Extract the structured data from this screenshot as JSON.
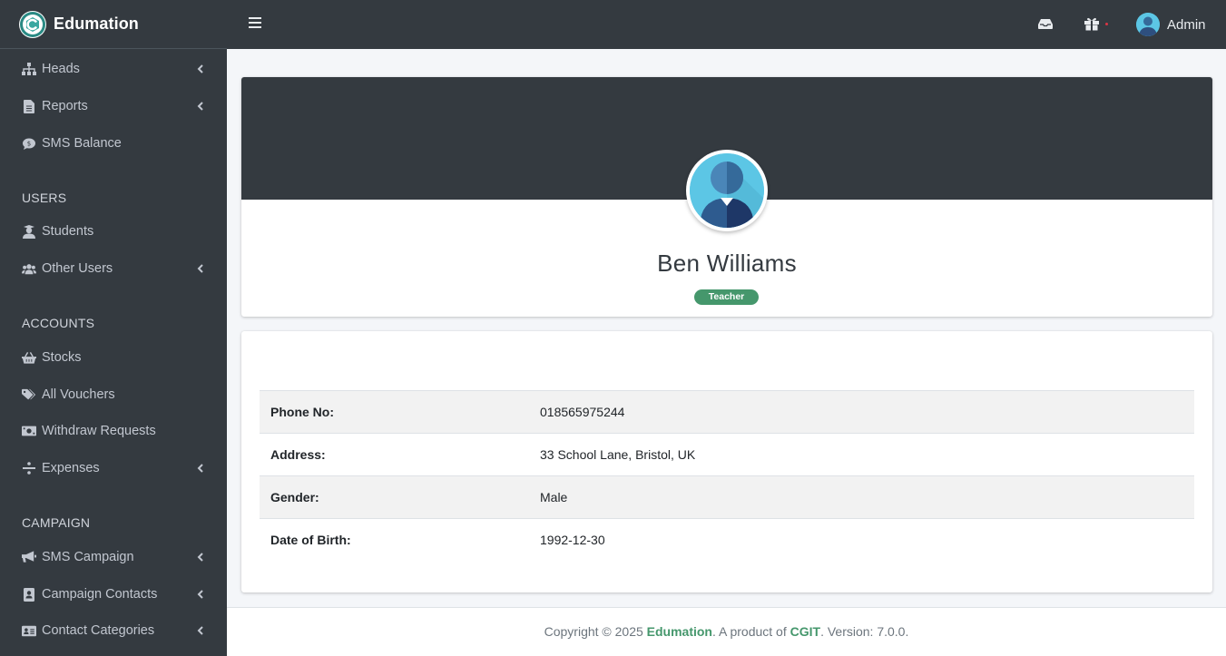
{
  "brand": {
    "name": "Edumation"
  },
  "sidebar": {
    "items": [
      {
        "label": "Heads",
        "icon": "sitemap-icon",
        "has_submenu": true
      },
      {
        "label": "Reports",
        "icon": "file-alt-icon",
        "has_submenu": true
      },
      {
        "label": "SMS Balance",
        "icon": "comment-dollar-icon",
        "has_submenu": false
      }
    ],
    "headers": [
      "USERS",
      "ACCOUNTS",
      "CAMPAIGN"
    ],
    "users_items": [
      {
        "label": "Students",
        "icon": "user-graduate-icon",
        "has_submenu": false
      },
      {
        "label": "Other Users",
        "icon": "users-icon",
        "has_submenu": true
      }
    ],
    "accounts_items": [
      {
        "label": "Stocks",
        "icon": "shopping-basket-icon",
        "has_submenu": false
      },
      {
        "label": "All Vouchers",
        "icon": "tags-icon",
        "has_submenu": false
      },
      {
        "label": "Withdraw Requests",
        "icon": "money-bill-icon",
        "has_submenu": false
      },
      {
        "label": "Expenses",
        "icon": "divide-icon",
        "has_submenu": true
      }
    ],
    "campaign_items": [
      {
        "label": "SMS Campaign",
        "icon": "bullhorn-icon",
        "has_submenu": true
      },
      {
        "label": "Campaign Contacts",
        "icon": "address-book-icon",
        "has_submenu": true
      },
      {
        "label": "Contact Categories",
        "icon": "address-card-icon",
        "has_submenu": true
      }
    ]
  },
  "topbar": {
    "user_name": "Admin",
    "icons": [
      "inbox-icon",
      "gift-icon"
    ]
  },
  "profile": {
    "name": "Ben Williams",
    "role": "Teacher"
  },
  "details": [
    {
      "key": "Phone No:",
      "value": "018565975244"
    },
    {
      "key": "Address:",
      "value": "33 School Lane, Bristol, UK"
    },
    {
      "key": "Gender:",
      "value": "Male"
    },
    {
      "key": "Date of Birth:",
      "value": "1992-12-30"
    }
  ],
  "footer": {
    "prefix": "Copyright © 2025 ",
    "brand": "Edumation",
    "middle": ". A product of ",
    "company": "CGIT",
    "suffix": ". Version: 7.0.0."
  },
  "colors": {
    "sidebar_bg": "#343a40",
    "accent_green": "#45976c",
    "avatar_blue": "#5cc6e5"
  }
}
